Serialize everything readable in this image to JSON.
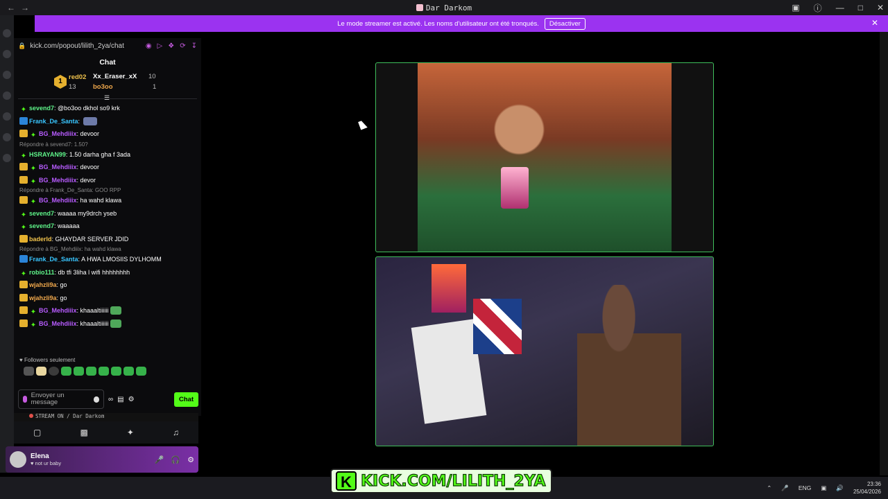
{
  "window": {
    "title": "Dar Darkom"
  },
  "banner": {
    "text": "Le mode streamer est activé. Les noms d'utilisateur ont été tronqués.",
    "button": "Désactiver"
  },
  "chat": {
    "url": "kick.com/popout/lilith_2ya/chat",
    "header": "Chat",
    "leaderboard": [
      {
        "rank": "1",
        "name": "red02",
        "count": "13"
      },
      {
        "name": "Xx_Eraser_xX",
        "count": "10"
      },
      {
        "name": "bo3oo",
        "count": "1"
      }
    ],
    "messages": [
      {
        "reply": "",
        "badges": [
          "plus"
        ],
        "user": "sevend7",
        "color": "#5ff58a",
        "text": "@bo3oo dkhol so9 krk",
        "emote": ""
      },
      {
        "reply": "",
        "badges": [
          "blue"
        ],
        "user": "Frank_De_Santa",
        "color": "#39c6ff",
        "text": "",
        "emote": "pc"
      },
      {
        "reply": "",
        "badges": [
          "crown",
          "plus"
        ],
        "user": "BG_Mehdiiix",
        "color": "#b85cff",
        "text": "devoor",
        "emote": ""
      },
      {
        "reply": "Répondre à sevend7: 1.50?",
        "badges": [
          "plus"
        ],
        "user": "HSRAYAN99",
        "color": "#5ff58a",
        "text": "1.50 darha gha f 3ada",
        "emote": ""
      },
      {
        "reply": "",
        "badges": [
          "crown",
          "plus"
        ],
        "user": "BG_Mehdiiix",
        "color": "#b85cff",
        "text": "devoor",
        "emote": ""
      },
      {
        "reply": "",
        "badges": [
          "crown",
          "plus"
        ],
        "user": "BG_Mehdiiix",
        "color": "#b85cff",
        "text": "devor",
        "emote": ""
      },
      {
        "reply": "Répondre à Frank_De_Santa: GOO RPP",
        "badges": [
          "crown",
          "plus"
        ],
        "user": "BG_Mehdiiix",
        "color": "#b85cff",
        "text": "ha wahd klawa",
        "emote": ""
      },
      {
        "reply": "",
        "badges": [
          "plus"
        ],
        "user": "sevend7",
        "color": "#5ff58a",
        "text": "waaaa my9drch yseb",
        "emote": ""
      },
      {
        "reply": "",
        "badges": [
          "plus"
        ],
        "user": "sevend7",
        "color": "#5ff58a",
        "text": "waaaaa",
        "emote": ""
      },
      {
        "reply": "",
        "badges": [
          "crown"
        ],
        "user": "baderld",
        "color": "#f0c24c",
        "text": "GHAYDAR SERVER JDID",
        "emote": ""
      },
      {
        "reply": "Répondre à BG_Mehdiiix: ha wahd klawa",
        "badges": [
          "blue"
        ],
        "user": "Frank_De_Santa",
        "color": "#39c6ff",
        "text": "A HWA LMOSIIS DYLHOMM",
        "emote": ""
      },
      {
        "reply": "",
        "badges": [
          "plus"
        ],
        "user": "robio111",
        "color": "#5ff58a",
        "text": "db tfi 3liha l wifi hhhhhhhh",
        "emote": ""
      },
      {
        "reply": "",
        "badges": [
          "crown"
        ],
        "user": "wjahzli9a",
        "color": "#f0a84c",
        "text": "go",
        "emote": ""
      },
      {
        "reply": "",
        "badges": [
          "crown"
        ],
        "user": "wjahzli9a",
        "color": "#f0a84c",
        "text": "go",
        "emote": ""
      },
      {
        "reply": "",
        "badges": [
          "crown",
          "plus"
        ],
        "user": "BG_Mehdiiix",
        "color": "#b85cff",
        "text": "khaaaltiiiiii",
        "emote": "pepe"
      },
      {
        "reply": "",
        "badges": [
          "crown",
          "plus"
        ],
        "user": "BG_Mehdiiix",
        "color": "#b85cff",
        "text": "khaaaltiiiiii",
        "emote": "pepe"
      }
    ],
    "followers_label": "Followers seulement",
    "input_placeholder": "Envoyer un message",
    "send_button": "Chat"
  },
  "discord": {
    "stream_status": "STREAM ON / Dar Darkom",
    "user_name": "Elena",
    "user_status": "not ur baby"
  },
  "taskbar": {
    "lang": "ENG",
    "time": "23:36",
    "date": "25/04/2026"
  },
  "overlay": {
    "text": "KICK.COM/LILITH_2YA",
    "logo_letter": "K"
  },
  "colors": {
    "banner": "#9b33f0",
    "kick_green": "#53fc18",
    "tile_border": "#3fbf5b"
  }
}
